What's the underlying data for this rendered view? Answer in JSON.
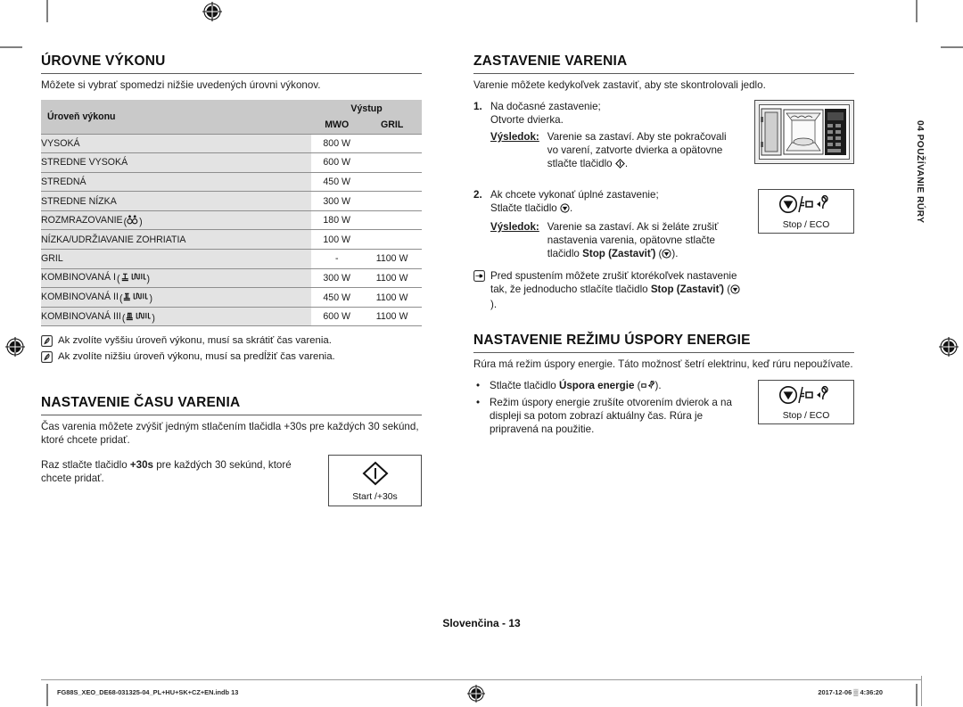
{
  "page": {
    "number_label": "Slovenčina - 13",
    "side_tab": "04 POUŽÍVANIE RÚRY"
  },
  "footer": {
    "file": "FG88S_XEO_DE68-031325-04_PL+HU+SK+CZ+EN.indb   13",
    "timestamp": "2017-12-06   ▒ 4:36:20"
  },
  "left_column": {
    "power_levels": {
      "heading": "ÚROVNE VÝKONU",
      "intro": "Môžete si vybrať spomedzi nižšie uvedených úrovni výkonov.",
      "table": {
        "header_level": "Úroveň výkonu",
        "header_output": "Výstup",
        "header_mwo": "MWO",
        "header_gril": "GRIL",
        "rows": [
          {
            "level": "VYSOKÁ",
            "icon": "",
            "mwo": "800 W",
            "gril": ""
          },
          {
            "level": "STREDNE VYSOKÁ",
            "icon": "",
            "mwo": "600 W",
            "gril": ""
          },
          {
            "level": "STREDNÁ",
            "icon": "",
            "mwo": "450 W",
            "gril": ""
          },
          {
            "level": "STREDNE NÍZKA",
            "icon": "",
            "mwo": "300 W",
            "gril": ""
          },
          {
            "level": "ROZMRAZOVANIE",
            "icon": "defrost-icon",
            "mwo": "180 W",
            "gril": ""
          },
          {
            "level": "NÍZKA/UDRŽIAVANIE ZOHRIATIA",
            "icon": "",
            "mwo": "100 W",
            "gril": ""
          },
          {
            "level": "GRIL",
            "icon": "",
            "mwo": "-",
            "gril": "1100 W"
          },
          {
            "level": "KOMBINOVANÁ I",
            "icon": "combi1-icon",
            "mwo": "300 W",
            "gril": "1100 W"
          },
          {
            "level": "KOMBINOVANÁ II",
            "icon": "combi2-icon",
            "mwo": "450 W",
            "gril": "1100 W"
          },
          {
            "level": "KOMBINOVANÁ III",
            "icon": "combi3-icon",
            "mwo": "600 W",
            "gril": "1100 W"
          }
        ]
      },
      "notes": [
        "Ak zvolíte vyššiu úroveň výkonu, musí sa skrátiť čas varenia.",
        "Ak zvolíte nižšiu úroveň výkonu, musí sa predĺžiť čas varenia."
      ]
    },
    "cook_time": {
      "heading": "NASTAVENIE ČASU VARENIA",
      "paragraph1": "Čas varenia môžete zvýšiť jedným stlačením tlačidla +30s pre každých 30 sekúnd, ktoré chcete pridať.",
      "paragraph2_pre": "Raz stlačte tlačidlo ",
      "paragraph2_bold": "+30s",
      "paragraph2_post": " pre každých 30 sekúnd, ktoré chcete pridať.",
      "key_label": "Start /+30s",
      "key_icon": "start-diamond-icon"
    }
  },
  "right_column": {
    "stop_cooking": {
      "heading": "ZASTAVENIE VARENIA",
      "intro": "Varenie môžete kedykoľvek zastaviť, aby ste skontrolovali jedlo.",
      "step1": {
        "num": "1.",
        "text": "Na dočasné zastavenie;\nOtvorte dvierka.",
        "result_label": "Výsledok:",
        "result_text_pre": "Varenie sa zastaví. Aby ste pokračovali vo varení, zatvorte dvierka a opätovne stlačte tlačidlo ",
        "result_text_post": "."
      },
      "step2": {
        "num": "2.",
        "text_pre": "Ak chcete vykonať úplné zastavenie;\nStlačte tlačidlo ",
        "text_post": ".",
        "result_label": "Výsledok:",
        "result_text_pre": "Varenie sa zastaví. Ak si želáte zrušiť nastavenia varenia, opätovne stlačte tlačidlo ",
        "result_bold": "Stop (Zastaviť)",
        "result_text_post": ")."
      },
      "hand_note_pre": "Pred spustením môžete zrušiť ktorékoľvek nastavenie tak, že jednoducho stlačíte tlačidlo ",
      "hand_note_bold": "Stop (Zastaviť)",
      "hand_note_post": ").",
      "oven_icon": "microwave-oven-open-door-icon",
      "key_label": "Stop / ECO",
      "key_icon": "stop-eco-icon"
    },
    "eco_mode": {
      "heading": "NASTAVENIE REŽIMU ÚSPORY ENERGIE",
      "intro": "Rúra má režim úspory energie. Táto možnosť šetrí elektrinu, keď rúru nepoužívate.",
      "bullets": [
        {
          "pre": "Stlačte tlačidlo ",
          "bold": "Úspora energie",
          "post": ")."
        },
        {
          "pre": "Režim úspory energie zrušíte otvorením dvierok a na displeji sa potom zobrazí aktuálny čas. Rúra je pripravená na použitie.",
          "bold": "",
          "post": ""
        }
      ],
      "key_label": "Stop / ECO",
      "key_icon": "stop-eco-icon"
    }
  },
  "colors": {
    "table_header_bg": "#c9c9c9",
    "table_row_label_bg": "#e3e3e3",
    "rule": "#5a5a5a"
  }
}
